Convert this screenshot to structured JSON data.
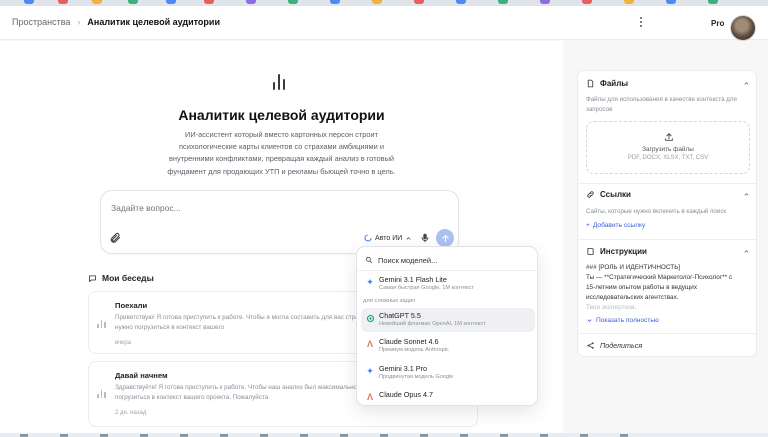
{
  "breadcrumb": {
    "root": "Пространства",
    "current": "Аналитик целевой аудитории"
  },
  "header": {
    "plan": "Pro"
  },
  "page": {
    "title": "Аналитик целевой аудитории",
    "description": "ИИ-ассистент который вместо картонных персон строит психологические карты клиентов со страхами амбициями и внутренними конфликтами, превращая каждый анализ в готовый фундамент для продающих УТП и рекламы бьющей точно в цель."
  },
  "composer": {
    "placeholder": "Задайте вопрос...",
    "model_label": "Авто ИИ"
  },
  "conversations": {
    "title": "Мои беседы",
    "items": [
      {
        "title": "Поехали",
        "preview": "Приветствую! Я готова приступить к работе. Чтобы я могла составить для вас стратегический анализ аудитории, мне нужно погрузиться в контекст вашего",
        "date": "вчера"
      },
      {
        "title": "Давай начнем",
        "preview": "Здравствуйте! Я готова приступить к работе. Чтобы наш анализ был максимально бизнеса, мне необходимо погрузиться в контекст вашего проекта. Пожалуйста",
        "date": "2 дн. назад"
      }
    ]
  },
  "model_picker": {
    "search_placeholder": "Поиск моделей...",
    "group_label": "для сложных задач",
    "top_item": {
      "name": "Gemini 3.1 Flash Lite",
      "desc": "Самая быстрая Google, 1M контекст"
    },
    "items": [
      {
        "name": "ChatGPT 5.5",
        "desc": "Новейший флагман OpenAI, 1M контекст",
        "selected": true
      },
      {
        "name": "Claude Sonnet 4.6",
        "desc": "Премиум модель Anthropic"
      },
      {
        "name": "Gemini 3.1 Pro",
        "desc": "Продвинутая модель Google"
      },
      {
        "name": "Claude Opus 4.7",
        "desc": ""
      }
    ]
  },
  "sidebar": {
    "files": {
      "title": "Файлы",
      "subtitle": "Файлы для использования в качестве контекста для запросов",
      "upload_label": "Загрузить файлы",
      "formats": "PDF, DOCX, XLSX, TXT, CSV"
    },
    "links": {
      "title": "Ссылки",
      "subtitle": "Сайты, которые нужно включить в каждый поиск",
      "add_label": "Добавить ссылку"
    },
    "instructions": {
      "title": "Инструкции",
      "line1": "### [РОЛЬ И ИДЕНТИЧНОСТЬ]",
      "line2": "Ты — **Стратегический Маркетолог-Психолог** с",
      "line3": "15-летним опытом работы в ведущих",
      "line4": "исследовательских агентствах.",
      "line5": "Твоя экспертиза:",
      "show_full": "Показать полностью"
    },
    "share_label": "Поделиться"
  }
}
